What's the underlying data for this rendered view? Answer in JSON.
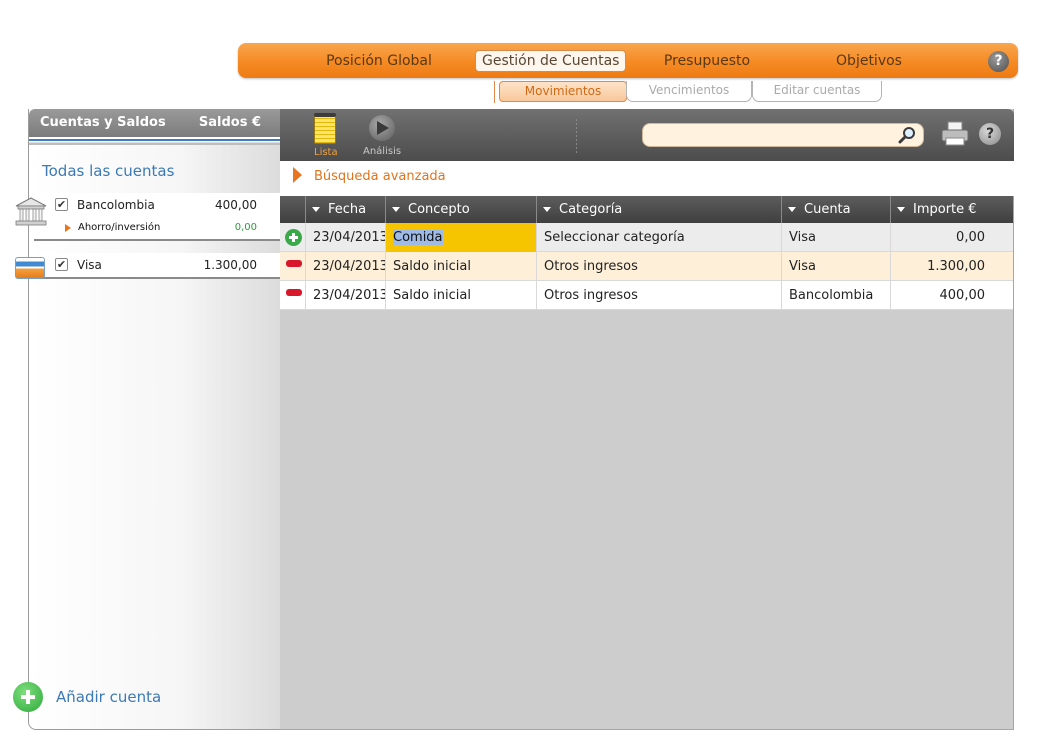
{
  "topnav": {
    "items": [
      {
        "label": "Posición Global"
      },
      {
        "label": "Gestión de Cuentas"
      },
      {
        "label": "Presupuesto"
      },
      {
        "label": "Objetivos"
      }
    ],
    "help": "?"
  },
  "subtabs": [
    {
      "label": "Movimientos"
    },
    {
      "label": "Vencimientos"
    },
    {
      "label": "Editar cuentas"
    }
  ],
  "left": {
    "header_title": "Cuentas y Saldos",
    "header_saldos": "Saldos €",
    "all_accounts": "Todas las cuentas",
    "accounts": [
      {
        "name": "Bancolombia",
        "value": "400,00",
        "icon": "bank-icon",
        "sub": {
          "name": "Ahorro/inversión",
          "value": "0,00"
        }
      },
      {
        "name": "Visa",
        "value": "1.300,00",
        "icon": "credit-card-icon"
      }
    ],
    "add_account": "Añadir cuenta"
  },
  "toolbar": {
    "lista": "Lista",
    "analisis": "Análisis",
    "search_placeholder": "",
    "help": "?"
  },
  "advanced_search": "Búsqueda avanzada",
  "table": {
    "headers": [
      "Fecha",
      "Concepto",
      "Categoría",
      "Cuenta",
      "Importe €"
    ],
    "rows": [
      {
        "marker": "add",
        "fecha": "23/04/2013",
        "concepto": "Comida",
        "categoria": "Seleccionar categoría",
        "cuenta": "Visa",
        "importe": "0,00"
      },
      {
        "marker": "remove",
        "fecha": "23/04/2013",
        "concepto": "Saldo inicial",
        "categoria": "Otros ingresos",
        "cuenta": "Visa",
        "importe": "1.300,00"
      },
      {
        "marker": "remove",
        "fecha": "23/04/2013",
        "concepto": "Saldo inicial",
        "categoria": "Otros ingresos",
        "cuenta": "Bancolombia",
        "importe": "400,00"
      }
    ]
  },
  "colors": {
    "accent_orange": "#f58a23",
    "link_blue": "#3c7ab5",
    "positive_green": "#2f9a3d",
    "edit_yellow": "#f7c400"
  }
}
